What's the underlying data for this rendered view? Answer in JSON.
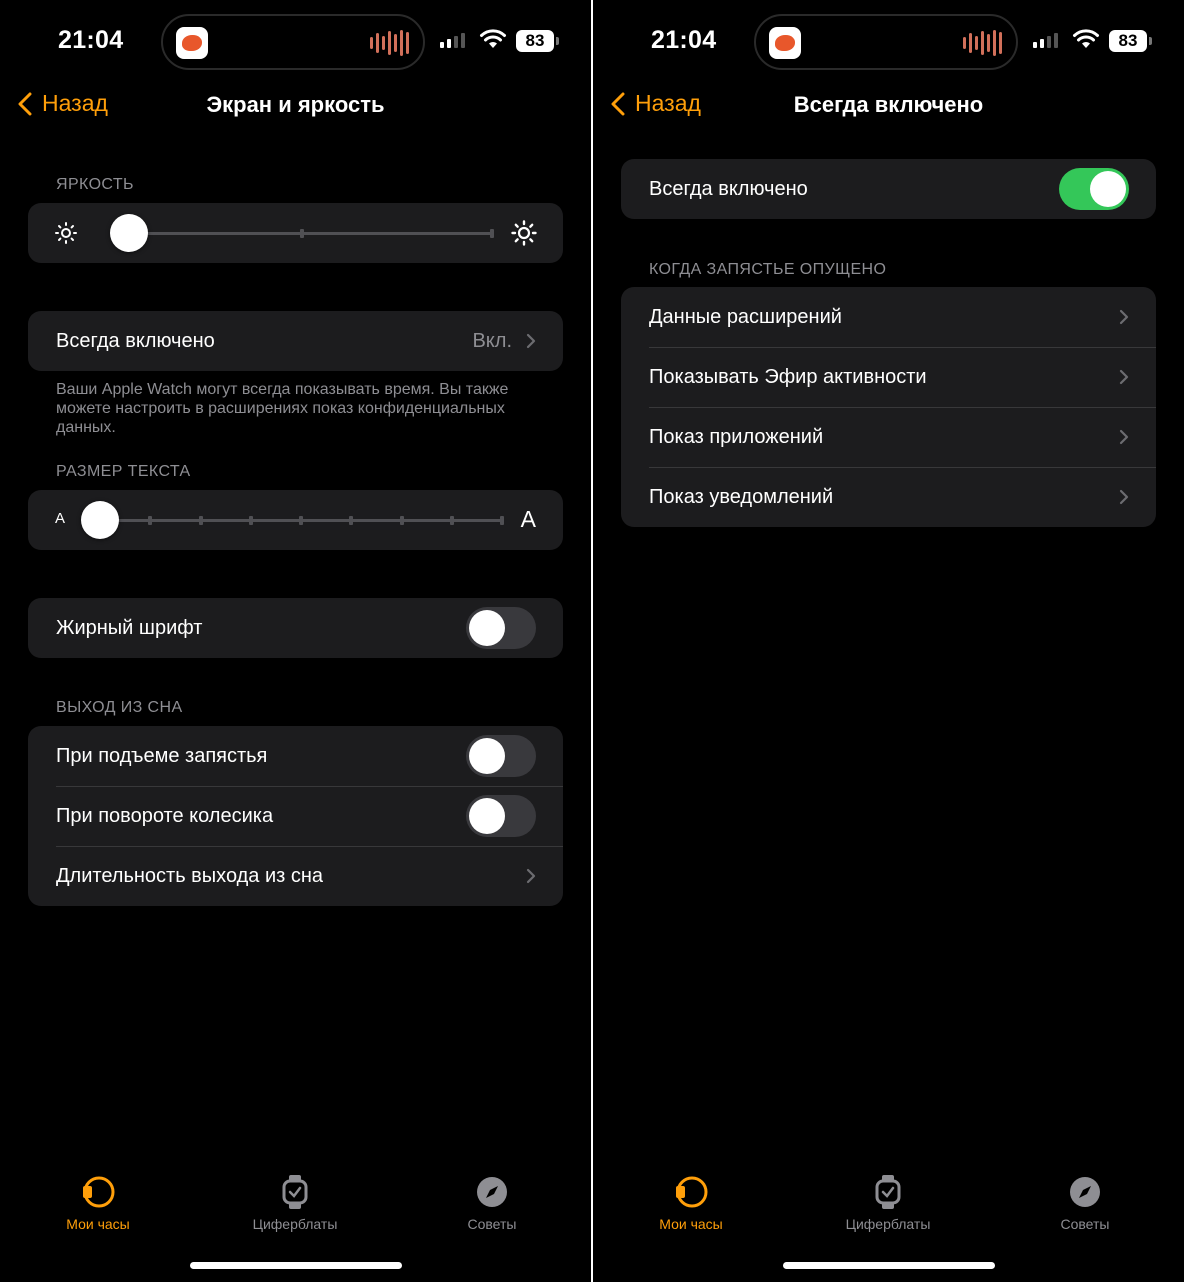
{
  "colors": {
    "accent": "#ff9f0a",
    "toggle_on": "#34c759",
    "cell_bg": "#1c1c1e",
    "secondary_text": "#8e8e93"
  },
  "status": {
    "time": "21:04",
    "battery": "83"
  },
  "tabs": [
    {
      "label": "Мои часы",
      "icon": "watch-face-icon",
      "active": true
    },
    {
      "label": "Циферблаты",
      "icon": "watch-icon",
      "active": false
    },
    {
      "label": "Советы",
      "icon": "compass-icon",
      "active": false
    }
  ],
  "left": {
    "back_label": "Назад",
    "title": "Экран и яркость",
    "brightness": {
      "header": "ЯРКОСТЬ",
      "level_fraction": 0.05
    },
    "always_on": {
      "label": "Всегда включено",
      "value": "Вкл."
    },
    "footnote": "Ваши Apple Watch могут всегда показывать время. Вы также можете настроить в расширениях показ конфиденциальных данных.",
    "text_size": {
      "header": "РАЗМЕР ТЕКСТА",
      "small_a": "A",
      "large_a": "A",
      "steps": 8,
      "selected_step": 0
    },
    "bold_text": {
      "label": "Жирный шрифт",
      "on": false
    },
    "wake": {
      "header": "ВЫХОД ИЗ СНА",
      "raise_wrist": {
        "label": "При подъеме запястья",
        "on": false
      },
      "crown_turn": {
        "label": "При повороте колесика",
        "on": false
      },
      "wake_duration": {
        "label": "Длительность выхода из сна"
      }
    }
  },
  "right": {
    "back_label": "Назад",
    "title": "Всегда включено",
    "always_on_toggle": {
      "label": "Всегда включено",
      "on": true
    },
    "wrist_down_header": "КОГДА ЗАПЯСТЬЕ ОПУЩЕНО",
    "items": [
      {
        "label": "Данные расширений"
      },
      {
        "label": "Показывать Эфир активности"
      },
      {
        "label": "Показ приложений"
      },
      {
        "label": "Показ уведомлений"
      }
    ]
  }
}
